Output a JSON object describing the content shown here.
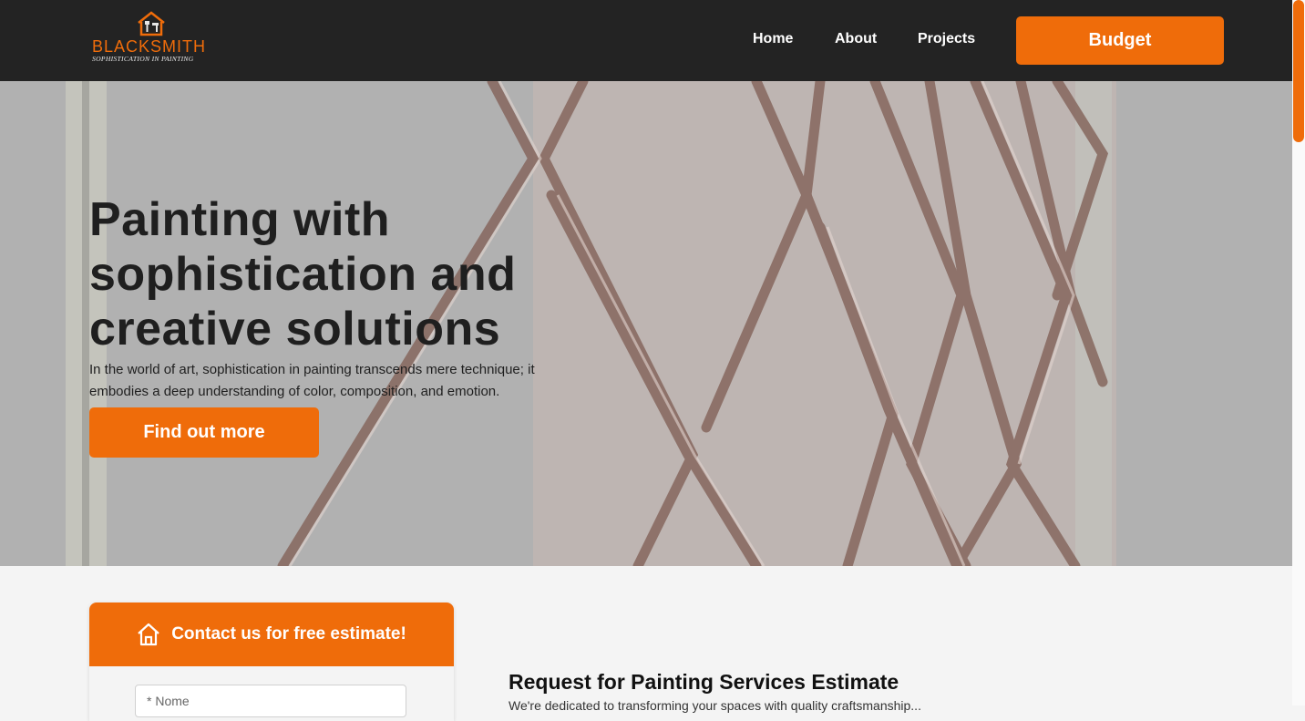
{
  "header": {
    "logo_name": "BLACKSMITH",
    "logo_tagline": "SOPHISTICATION IN PAINTING",
    "nav": [
      "Home",
      "About",
      "Projects"
    ],
    "budget_label": "Budget"
  },
  "hero": {
    "title": "Painting with sophistication and creative solutions",
    "text": "In the world of art, sophistication in painting transcends mere technique; it embodies a deep understanding of color, composition, and emotion.",
    "cta_label": "Find out more"
  },
  "contact": {
    "heading": "Contact us for free estimate!",
    "name_placeholder": "* Nome"
  },
  "estimate": {
    "title": "Request for Painting Services Estimate",
    "text": "We're dedicated to transforming your spaces with quality craftsmanship..."
  },
  "colors": {
    "accent": "#ef6c0a",
    "header_bg": "#232323",
    "page_bg": "#f4f4f4"
  },
  "icons": {
    "logo": "house-brush-icon",
    "contact": "house-icon"
  }
}
